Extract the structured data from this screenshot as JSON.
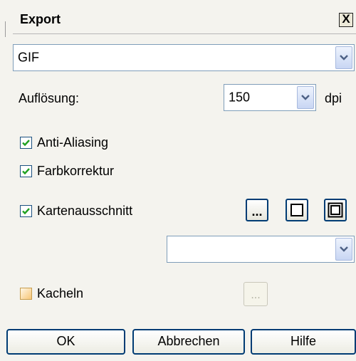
{
  "dialog": {
    "title": "Export",
    "close_glyph": "X"
  },
  "format": {
    "value": "GIF"
  },
  "resolution": {
    "label": "Auflösung:",
    "value": "150",
    "unit": "dpi"
  },
  "options": {
    "anti_aliasing": {
      "label": "Anti-Aliasing",
      "checked": true
    },
    "color_correction": {
      "label": "Farbkorrektur",
      "checked": true
    },
    "map_extent": {
      "label": "Kartenausschnitt",
      "checked": true,
      "browse_label": "..."
    },
    "map_extent_select": {
      "value": ""
    },
    "tiles": {
      "label": "Kacheln",
      "checked": false,
      "browse_label": "..."
    }
  },
  "buttons": {
    "ok": "OK",
    "cancel": "Abbrechen",
    "help": "Hilfe"
  },
  "colors": {
    "accent_border": "#003c74",
    "check": "#21a121",
    "input_border": "#7f9db9"
  }
}
